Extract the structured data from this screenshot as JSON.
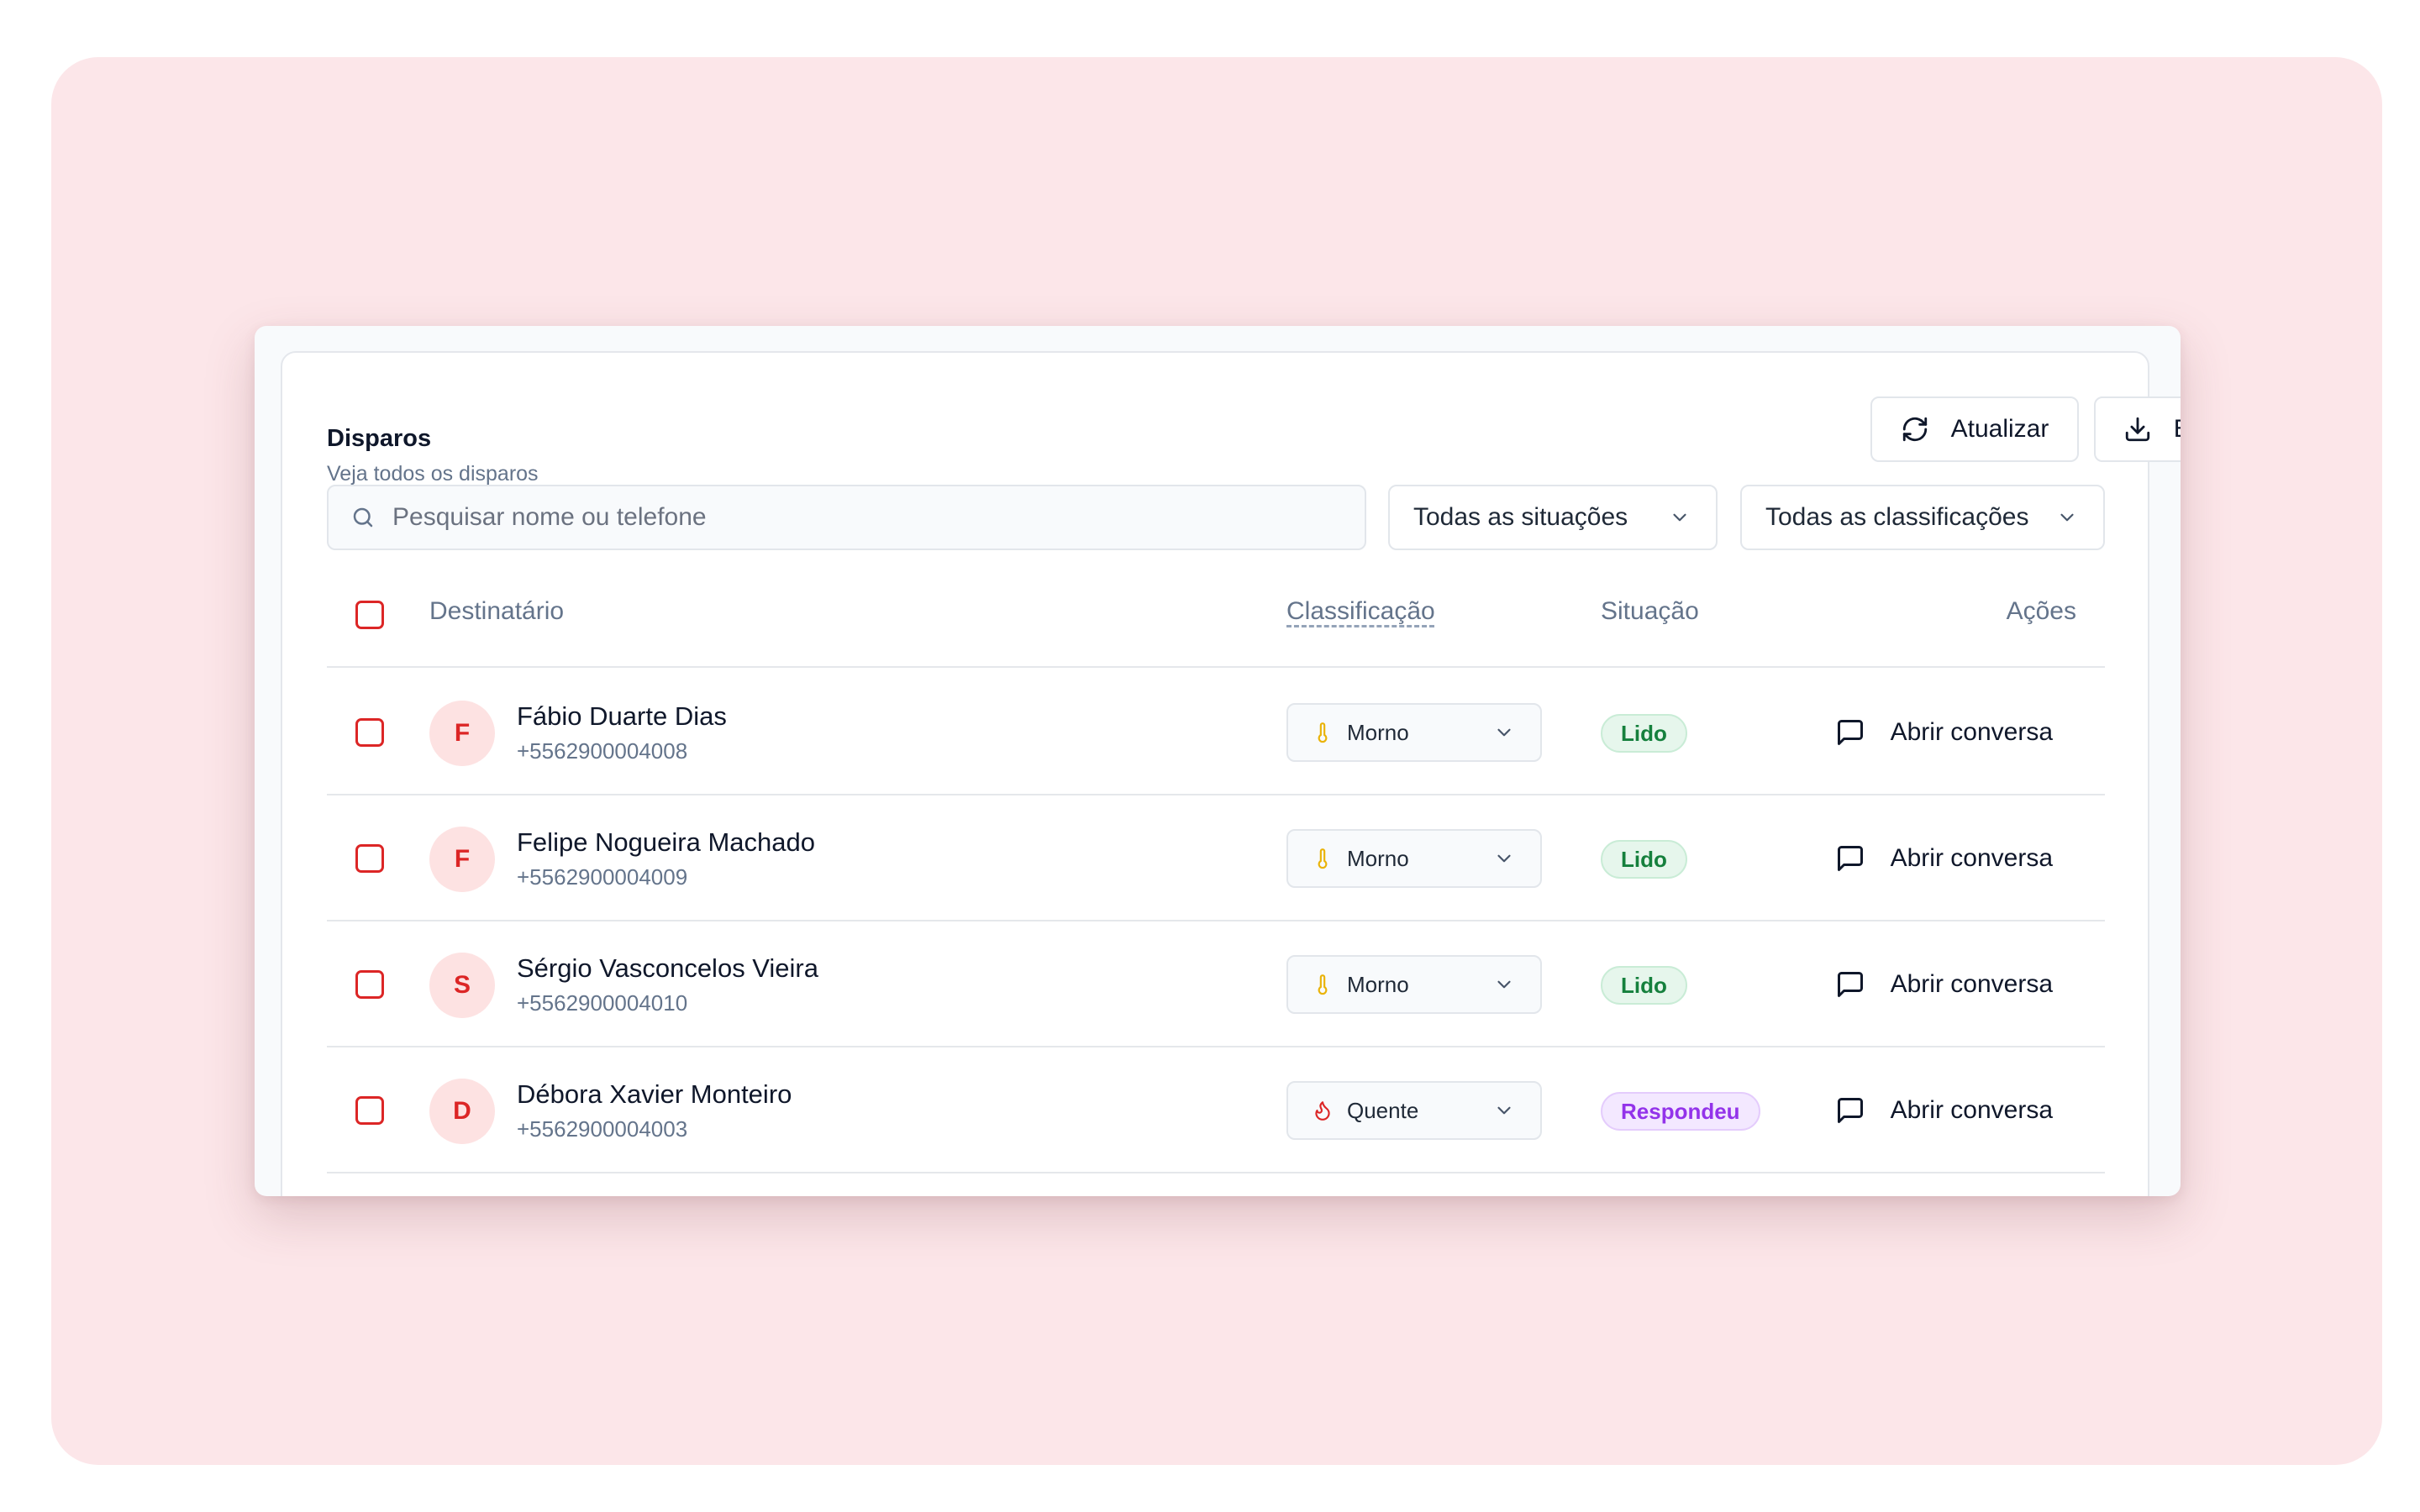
{
  "header": {
    "title": "Disparos",
    "subtitle": "Veja todos os disparos",
    "refresh_label": "Atualizar",
    "export_label": "Exportar CSV"
  },
  "filters": {
    "search_placeholder": "Pesquisar nome ou telefone",
    "status_selected": "Todas as situações",
    "classification_selected": "Todas as classificações"
  },
  "table": {
    "columns": {
      "recipient": "Destinatário",
      "classification": "Classificação",
      "status": "Situação",
      "actions": "Ações"
    },
    "rows": [
      {
        "initial": "F",
        "name": "Fábio Duarte Dias",
        "phone": "+5562900004008",
        "classification": "Morno",
        "classification_icon": "thermometer-icon",
        "status": "Lido",
        "action": "Abrir conversa"
      },
      {
        "initial": "F",
        "name": "Felipe Nogueira Machado",
        "phone": "+5562900004009",
        "classification": "Morno",
        "classification_icon": "thermometer-icon",
        "status": "Lido",
        "action": "Abrir conversa"
      },
      {
        "initial": "S",
        "name": "Sérgio Vasconcelos Vieira",
        "phone": "+5562900004010",
        "classification": "Morno",
        "classification_icon": "thermometer-icon",
        "status": "Lido",
        "action": "Abrir conversa"
      },
      {
        "initial": "D",
        "name": "Débora Xavier Monteiro",
        "phone": "+5562900004003",
        "classification": "Quente",
        "classification_icon": "flame-icon",
        "status": "Respondeu",
        "action": "Abrir conversa"
      }
    ]
  },
  "colors": {
    "backdrop": "#fce6e9",
    "accent_red": "#dc2626",
    "warm_yellow": "#eab308",
    "read_green": "#15803d",
    "replied_purple": "#9333ea"
  }
}
